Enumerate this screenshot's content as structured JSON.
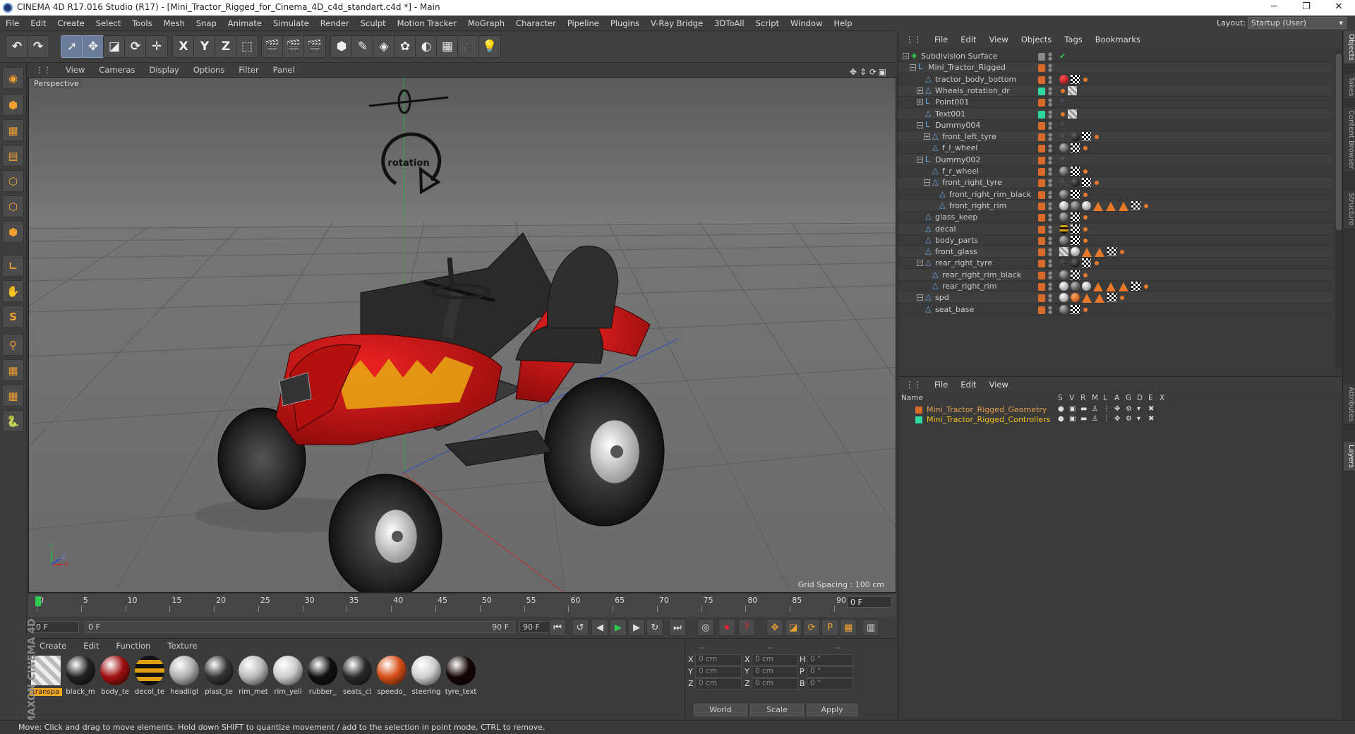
{
  "window": {
    "title": "CINEMA 4D R17.016 Studio (R17) - [Mini_Tractor_Rigged_for_Cinema_4D_c4d_standart.c4d *] - Main",
    "controls": [
      "─",
      "❐",
      "✕"
    ]
  },
  "menubar": [
    "File",
    "Edit",
    "Create",
    "Select",
    "Tools",
    "Mesh",
    "Snap",
    "Animate",
    "Simulate",
    "Render",
    "Sculpt",
    "Motion Tracker",
    "MoGraph",
    "Character",
    "Pipeline",
    "Plugins",
    "V-Ray Bridge",
    "3DToAll",
    "Script",
    "Window",
    "Help"
  ],
  "layout": {
    "label": "Layout:",
    "value": "Startup (User)"
  },
  "toolbar": [
    {
      "name": "undo-icon",
      "glyph": "↶"
    },
    {
      "name": "redo-icon",
      "glyph": "↷"
    },
    {
      "name": "live-selection-icon",
      "glyph": "➚",
      "selected": true
    },
    {
      "name": "move-icon",
      "glyph": "✥",
      "selected": true
    },
    {
      "name": "scale-icon",
      "glyph": "◪"
    },
    {
      "name": "rotate-icon",
      "glyph": "⟳"
    },
    {
      "name": "recent-tools-icon",
      "glyph": "✛"
    },
    {
      "name": "x-axis-lock-icon",
      "glyph": "X"
    },
    {
      "name": "y-axis-lock-icon",
      "glyph": "Y"
    },
    {
      "name": "z-axis-lock-icon",
      "glyph": "Z"
    },
    {
      "name": "coordinate-system-icon",
      "glyph": "⬚"
    },
    {
      "name": "render-view-icon",
      "glyph": "🎬"
    },
    {
      "name": "render-picture-viewer-icon",
      "glyph": "🎬"
    },
    {
      "name": "edit-render-settings-icon",
      "glyph": "🎬"
    },
    {
      "name": "cube-icon",
      "glyph": "⬢"
    },
    {
      "name": "pen-spline-icon",
      "glyph": "✎"
    },
    {
      "name": "subdivision-icon",
      "glyph": "◈"
    },
    {
      "name": "array-icon",
      "glyph": "✿"
    },
    {
      "name": "deformer-icon",
      "glyph": "◐"
    },
    {
      "name": "floor-icon",
      "glyph": "▦"
    },
    {
      "name": "camera-icon",
      "glyph": "🎥"
    },
    {
      "name": "light-icon",
      "glyph": "💡"
    }
  ],
  "lefttools": [
    {
      "name": "make-editable-icon",
      "glyph": "◉"
    },
    {
      "name": "model-mode-icon",
      "glyph": "⬢"
    },
    {
      "name": "texture-mode-icon",
      "glyph": "▦"
    },
    {
      "name": "workplane-mode-icon",
      "glyph": "▤"
    },
    {
      "name": "points-mode-icon",
      "glyph": "⬡"
    },
    {
      "name": "edges-mode-icon",
      "glyph": "⬡"
    },
    {
      "name": "polygons-mode-icon",
      "glyph": "⬢"
    },
    {
      "name": "axis-mode-icon",
      "glyph": "∟"
    },
    {
      "name": "tweak-mode-icon",
      "glyph": "✋"
    },
    {
      "name": "snap-icon",
      "glyph": "S"
    },
    {
      "name": "magnet-icon",
      "glyph": "⚲"
    },
    {
      "name": "workplane-lock-icon",
      "glyph": "▦"
    },
    {
      "name": "grid-snap-icon",
      "glyph": "▦"
    },
    {
      "name": "python-icon",
      "glyph": "🐍"
    }
  ],
  "viewport": {
    "menu": [
      "View",
      "Cameras",
      "Display",
      "Options",
      "Filter",
      "Panel"
    ],
    "label": "Perspective",
    "grid_spacing": "Grid Spacing : 100 cm",
    "annotation": "rotation"
  },
  "timeline": {
    "ticks": [
      "0",
      "5",
      "10",
      "15",
      "20",
      "25",
      "30",
      "35",
      "40",
      "45",
      "50",
      "55",
      "60",
      "65",
      "70",
      "75",
      "80",
      "85",
      "90"
    ],
    "current": "0 F",
    "start": "0 F",
    "range_start": "0 F",
    "range_end": "90 F",
    "end": "90 F"
  },
  "transport": [
    {
      "name": "goto-start-icon",
      "glyph": "⏮"
    },
    {
      "name": "prev-key-icon",
      "glyph": "↺"
    },
    {
      "name": "prev-frame-icon",
      "glyph": "◀"
    },
    {
      "name": "play-icon",
      "glyph": "▶"
    },
    {
      "name": "next-frame-icon",
      "glyph": "▶"
    },
    {
      "name": "next-key-icon",
      "glyph": "↻"
    },
    {
      "name": "goto-end-icon",
      "glyph": "⏭"
    },
    {
      "name": "motion-record-icon",
      "glyph": "◎"
    },
    {
      "name": "record-icon",
      "glyph": "⏺"
    },
    {
      "name": "auto-key-icon",
      "glyph": "?"
    },
    {
      "name": "key-position-icon",
      "glyph": "✥"
    },
    {
      "name": "key-scale-icon",
      "glyph": "◪"
    },
    {
      "name": "key-rotation-icon",
      "glyph": "⟳"
    },
    {
      "name": "key-param-icon",
      "glyph": "P"
    },
    {
      "name": "key-pla-icon",
      "glyph": "▦"
    },
    {
      "name": "timeline-icon",
      "glyph": "▥"
    }
  ],
  "materials": {
    "menu": [
      "Create",
      "Edit",
      "Function",
      "Texture"
    ],
    "items": [
      {
        "name": "transpa",
        "color": "#d8d8d8",
        "selected": true
      },
      {
        "name": "black_m",
        "color": "#222222"
      },
      {
        "name": "body_te",
        "color": "#a01010"
      },
      {
        "name": "decol_te",
        "color": "#e0a010"
      },
      {
        "name": "headligl",
        "color": "#b0b0b0"
      },
      {
        "name": "plast_te",
        "color": "#333333"
      },
      {
        "name": "rim_met",
        "color": "#bbbbbb"
      },
      {
        "name": "rim_yell",
        "color": "#cccccc"
      },
      {
        "name": "rubber_",
        "color": "#111111"
      },
      {
        "name": "seats_cl",
        "color": "#2a2a2a"
      },
      {
        "name": "speedo_",
        "color": "#d8501a"
      },
      {
        "name": "steering",
        "color": "#d0d0d0"
      },
      {
        "name": "tyre_text",
        "color": "#150505"
      }
    ]
  },
  "coords": {
    "headers": [
      "--",
      "--",
      "--"
    ],
    "rows": [
      {
        "a": "X",
        "av": "0 cm",
        "b": "X",
        "bv": "0 cm",
        "c": "H",
        "cv": "0 °"
      },
      {
        "a": "Y",
        "av": "0 cm",
        "b": "Y",
        "bv": "0 cm",
        "c": "P",
        "cv": "0 °"
      },
      {
        "a": "Z",
        "av": "0 cm",
        "b": "Z",
        "bv": "0 cm",
        "c": "B",
        "cv": "0 °"
      }
    ],
    "world": "World",
    "scale": "Scale",
    "apply": "Apply"
  },
  "status": "Move: Click and drag to move elements. Hold down SHIFT to quantize movement / add to the selection in point mode, CTRL to remove.",
  "maxon": "MAXON CINEMA 4D",
  "objects": {
    "menu": [
      "File",
      "Edit",
      "View",
      "Objects",
      "Tags",
      "Bookmarks"
    ],
    "rows": [
      {
        "name": "Subdivision Surface",
        "depth": 0,
        "exp": "−",
        "icon": "◈",
        "layer": "none",
        "tags": [
          "check"
        ]
      },
      {
        "name": "Mini_Tractor_Rigged",
        "depth": 1,
        "exp": "−",
        "icon": "L",
        "layer": "orange",
        "tags": []
      },
      {
        "name": "tractor_body_bottom",
        "depth": 2,
        "exp": "",
        "icon": "△",
        "layer": "orange",
        "tags": [
          "red",
          "checker",
          "dot"
        ]
      },
      {
        "name": "Wheels_rotation_dr",
        "depth": 2,
        "exp": "+",
        "icon": "△",
        "layer": "green",
        "tags": [
          "dot",
          "gray"
        ]
      },
      {
        "name": "Point001",
        "depth": 2,
        "exp": "+",
        "icon": "L",
        "layer": "orange",
        "tags": [
          "dots"
        ]
      },
      {
        "name": "Text001",
        "depth": 2,
        "exp": "",
        "icon": "△",
        "layer": "green",
        "tags": [
          "dot",
          "gray"
        ]
      },
      {
        "name": "Dummy004",
        "depth": 2,
        "exp": "−",
        "icon": "L",
        "layer": "orange",
        "tags": [
          "dots"
        ]
      },
      {
        "name": "front_left_tyre",
        "depth": 3,
        "exp": "+",
        "icon": "△",
        "layer": "orange",
        "tags": [
          "dots",
          "black",
          "checker",
          "dot"
        ]
      },
      {
        "name": "f_l_wheel",
        "depth": 3,
        "exp": "",
        "icon": "△",
        "layer": "orange",
        "tags": [
          "dark",
          "checker",
          "dot"
        ]
      },
      {
        "name": "Dummy002",
        "depth": 2,
        "exp": "−",
        "icon": "L",
        "layer": "orange",
        "tags": [
          "dots"
        ]
      },
      {
        "name": "f_r_wheel",
        "depth": 3,
        "exp": "",
        "icon": "△",
        "layer": "orange",
        "tags": [
          "dark",
          "checker",
          "dot"
        ]
      },
      {
        "name": "front_right_tyre",
        "depth": 3,
        "exp": "−",
        "icon": "△",
        "layer": "orange",
        "tags": [
          "dots",
          "black",
          "checker",
          "dot"
        ]
      },
      {
        "name": "front_right_rim_black",
        "depth": 4,
        "exp": "",
        "icon": "△",
        "layer": "orange",
        "tags": [
          "dark",
          "checker",
          "dot"
        ]
      },
      {
        "name": "front_right_rim",
        "depth": 4,
        "exp": "",
        "icon": "△",
        "layer": "orange",
        "tags": [
          "silver",
          "dark",
          "silver",
          "tri",
          "tri",
          "tri",
          "checker",
          "dot"
        ]
      },
      {
        "name": "glass_keep",
        "depth": 2,
        "exp": "",
        "icon": "△",
        "layer": "orange",
        "tags": [
          "dark",
          "checker",
          "dot"
        ]
      },
      {
        "name": "decal",
        "depth": 2,
        "exp": "",
        "icon": "△",
        "layer": "orange",
        "tags": [
          "stripe",
          "checker",
          "dot"
        ]
      },
      {
        "name": "body_parts",
        "depth": 2,
        "exp": "",
        "icon": "△",
        "layer": "orange",
        "tags": [
          "dark",
          "checker",
          "dot"
        ]
      },
      {
        "name": "front_glass",
        "depth": 2,
        "exp": "",
        "icon": "△",
        "layer": "orange",
        "tags": [
          "gray",
          "silver",
          "tri",
          "tri",
          "checker",
          "dot"
        ]
      },
      {
        "name": "rear_right_tyre",
        "depth": 2,
        "exp": "−",
        "icon": "△",
        "layer": "orange",
        "tags": [
          "dots",
          "black",
          "checker",
          "dot"
        ]
      },
      {
        "name": "rear_right_rim_black",
        "depth": 3,
        "exp": "",
        "icon": "△",
        "layer": "orange",
        "tags": [
          "dark",
          "checker",
          "dot"
        ]
      },
      {
        "name": "rear_right_rim",
        "depth": 3,
        "exp": "",
        "icon": "△",
        "layer": "orange",
        "tags": [
          "silver",
          "dark",
          "silver",
          "tri",
          "tri",
          "tri",
          "checker",
          "dot"
        ]
      },
      {
        "name": "spd",
        "depth": 2,
        "exp": "−",
        "icon": "△",
        "layer": "orange",
        "tags": [
          "silver",
          "orange",
          "tri",
          "tri",
          "checker",
          "dot"
        ]
      },
      {
        "name": "seat_base",
        "depth": 2,
        "exp": "",
        "icon": "△",
        "layer": "orange",
        "tags": [
          "dark",
          "checker",
          "dot"
        ]
      }
    ]
  },
  "layers": {
    "menu": [
      "File",
      "Edit",
      "View"
    ],
    "header_name": "Name",
    "flags": [
      "S",
      "V",
      "R",
      "M",
      "L",
      "A",
      "G",
      "D",
      "E",
      "X"
    ],
    "rows": [
      {
        "name": "Mini_Tractor_Rigged_Geometry",
        "color": "#d86a2a",
        "text": "#e6a04a"
      },
      {
        "name": "Mini_Tractor_Rigged_Controllers",
        "color": "#2ed8a0",
        "text": "#f0c020"
      }
    ]
  },
  "rtabs": {
    "top": [
      "Objects",
      "Takes",
      "Content Browser",
      "Structure"
    ],
    "bottom": [
      "Attributes",
      "Layers"
    ]
  }
}
